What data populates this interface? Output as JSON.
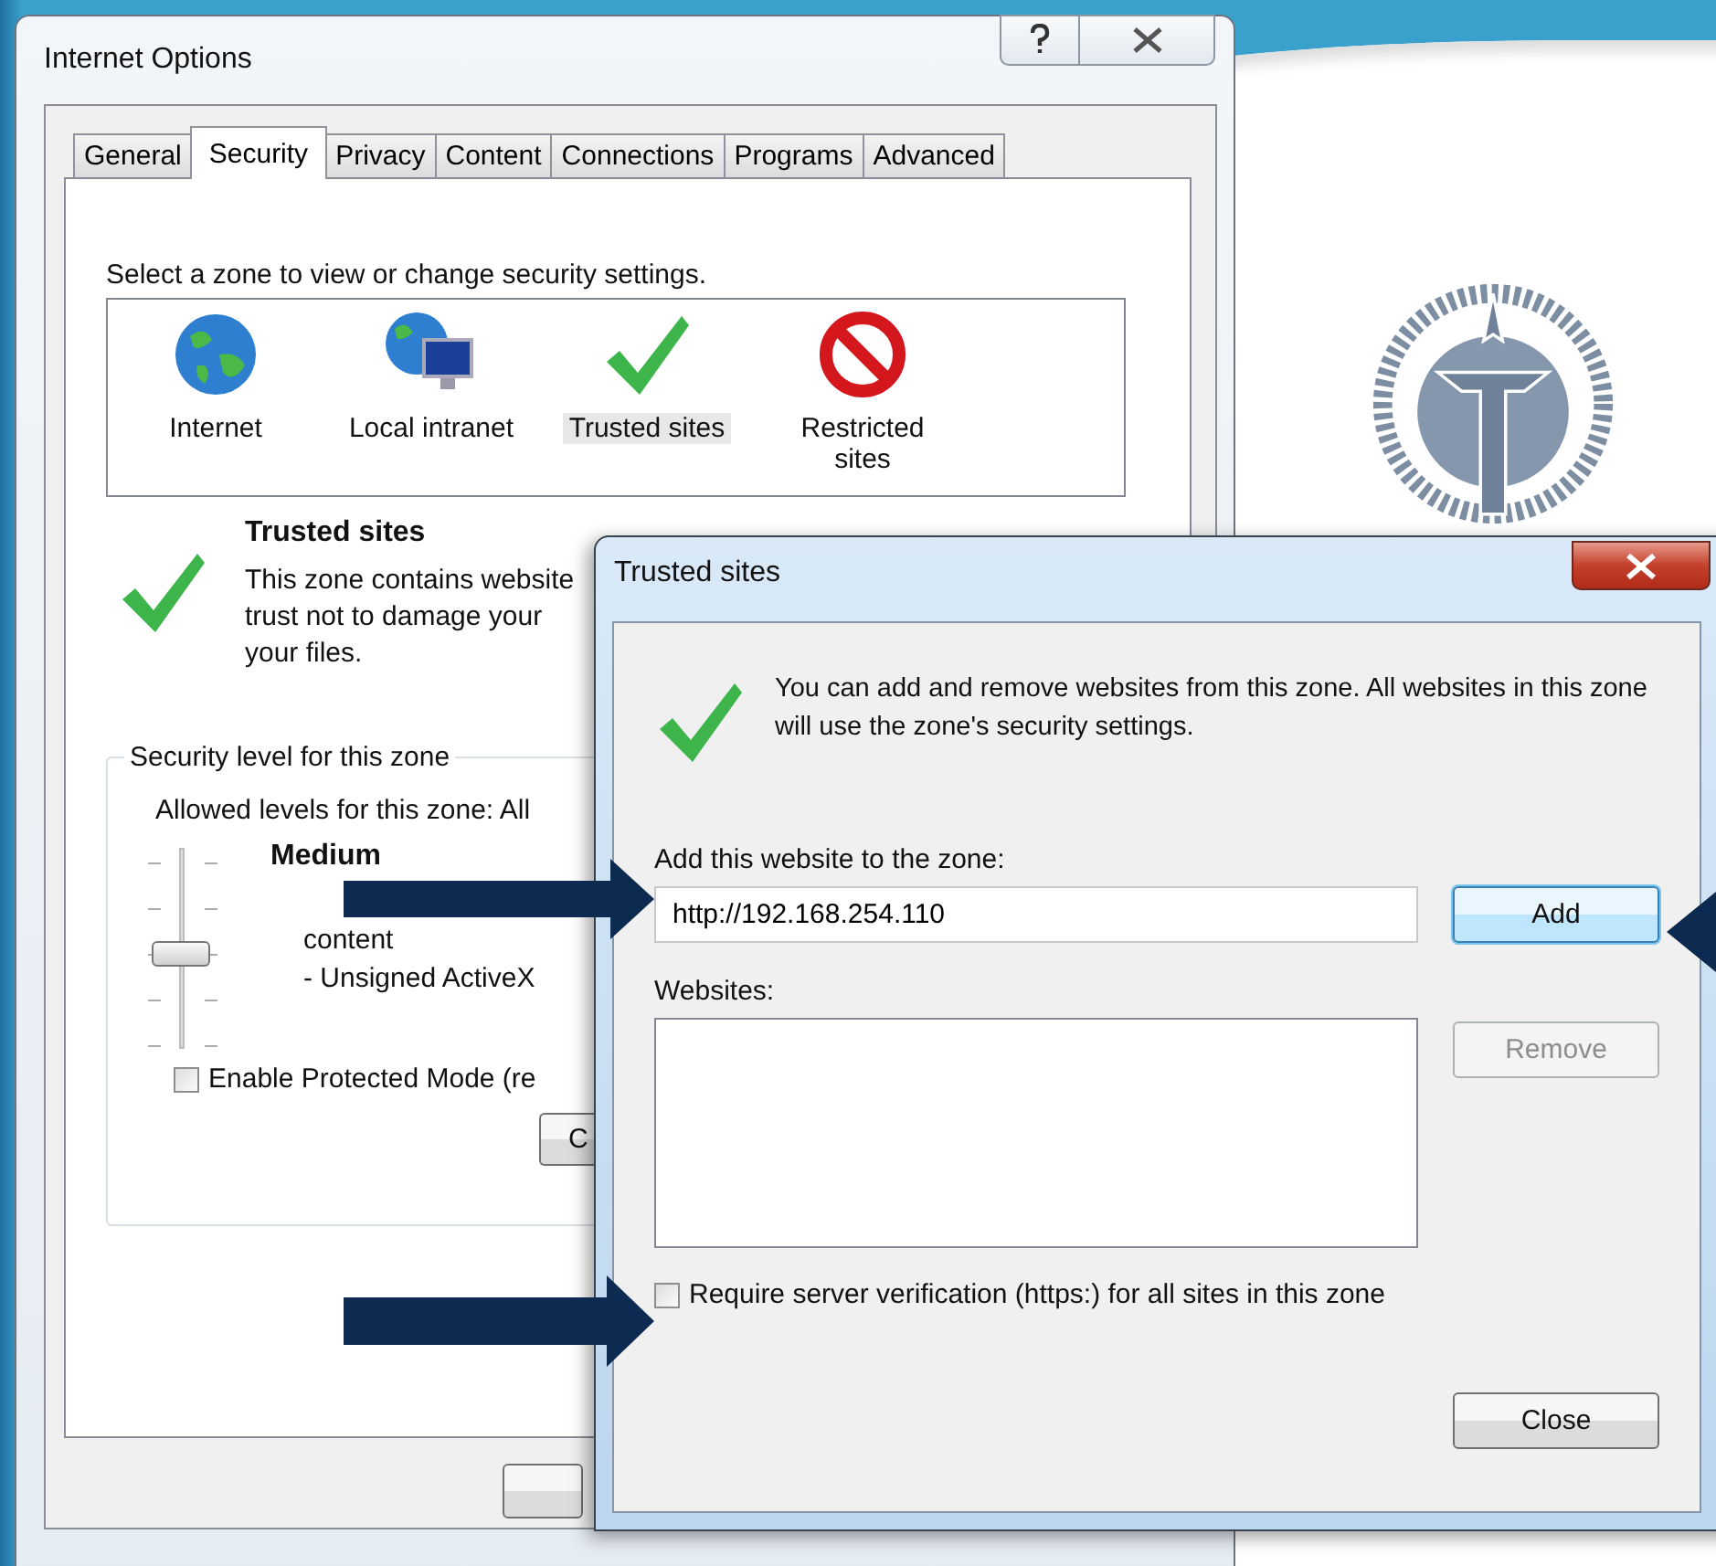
{
  "internet_options": {
    "title": "Internet Options",
    "tabs": [
      {
        "label": "General",
        "selected": false
      },
      {
        "label": "Security",
        "selected": true
      },
      {
        "label": "Privacy",
        "selected": false
      },
      {
        "label": "Content",
        "selected": false
      },
      {
        "label": "Connections",
        "selected": false
      },
      {
        "label": "Programs",
        "selected": false
      },
      {
        "label": "Advanced",
        "selected": false
      }
    ],
    "prompt": "Select a zone to view or change security settings.",
    "zones": [
      {
        "kind": "internet",
        "label": "Internet",
        "selected": false
      },
      {
        "kind": "intranet",
        "label": "Local intranet",
        "selected": false
      },
      {
        "kind": "trusted",
        "label": "Trusted sites",
        "selected": true
      },
      {
        "kind": "restricted",
        "label": "Restricted sites",
        "selected": false
      }
    ],
    "zone_heading": "Trusted sites",
    "zone_description": [
      "This zone contains website",
      "trust not to damage your",
      "your files."
    ],
    "security_group": {
      "legend": "Security level for this zone",
      "allowed_levels": "Allowed levels for this zone: All",
      "slider": {
        "level": 0.5
      },
      "level_name": "Medium",
      "level_details": [
        "content",
        "- Unsigned ActiveX"
      ],
      "protected_mode": {
        "label": "Enable Protected Mode (re",
        "checked": false
      },
      "button_label": "C"
    }
  },
  "trusted_sites": {
    "title": "Trusted sites",
    "info": "You can add and remove websites from this zone. All websites in this zone will use the zone's security settings.",
    "add_label": "Add this website to the zone:",
    "website_field": {
      "value": "http://192.168.254.110"
    },
    "add_button": {
      "label": "Add",
      "default": true
    },
    "websites_label": "Websites:",
    "remove_button": {
      "label": "Remove",
      "disabled": true
    },
    "https_checkbox": {
      "label": "Require server verification (https:) for all sites in this zone",
      "checked": false
    },
    "close_button": "Close"
  }
}
